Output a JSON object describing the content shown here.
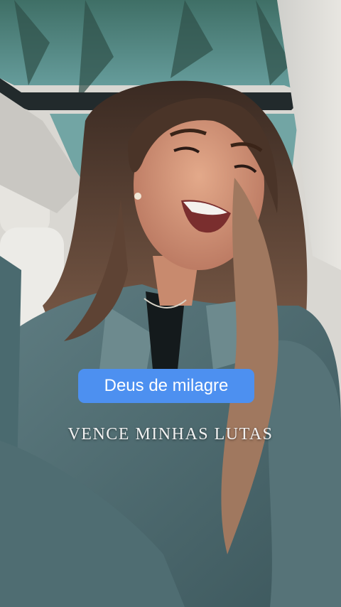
{
  "video": {
    "caption_highlight": "Deus de milagre",
    "lyric_text": "VENCE MINHAS LUTAS"
  },
  "colors": {
    "caption_background": "#4d90f0",
    "caption_text": "#ffffff",
    "lyric_text": "#f2f2f2"
  }
}
